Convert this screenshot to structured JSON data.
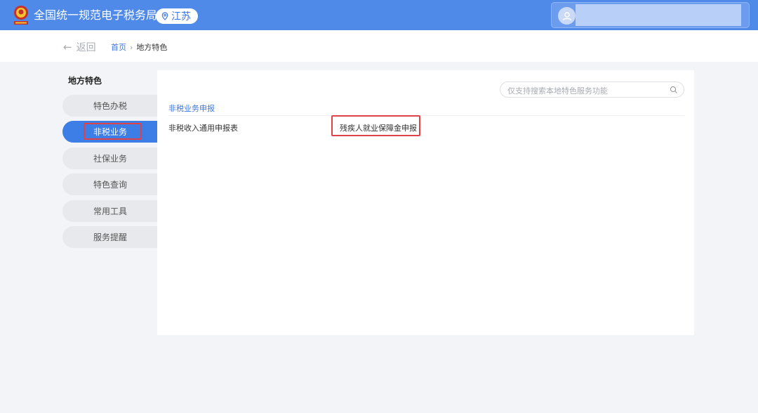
{
  "header": {
    "site_title": "全国统一规范电子税务局",
    "region": "江苏",
    "emblem_icon": "tax-emblem-icon",
    "location_icon": "location-pin-icon",
    "avatar_icon": "user-avatar-icon",
    "brand_color": "#4f8ae8"
  },
  "breadcrumb": {
    "back_label": "返回",
    "home": "首页",
    "separator": "›",
    "current": "地方特色"
  },
  "sidebar": {
    "title": "地方特色",
    "items": [
      {
        "label": "特色办税",
        "active": false
      },
      {
        "label": "非税业务",
        "active": true
      },
      {
        "label": "社保业务",
        "active": false
      },
      {
        "label": "特色查询",
        "active": false
      },
      {
        "label": "常用工具",
        "active": false
      },
      {
        "label": "服务提醒",
        "active": false
      }
    ],
    "active_color": "#3d7ee6"
  },
  "main": {
    "search_placeholder": "仅支持搜索本地特色服务功能",
    "section_title": "非税业务申报",
    "rows": [
      {
        "label": "非税收入通用申报表",
        "link": "残疾人就业保障金申报"
      }
    ]
  }
}
